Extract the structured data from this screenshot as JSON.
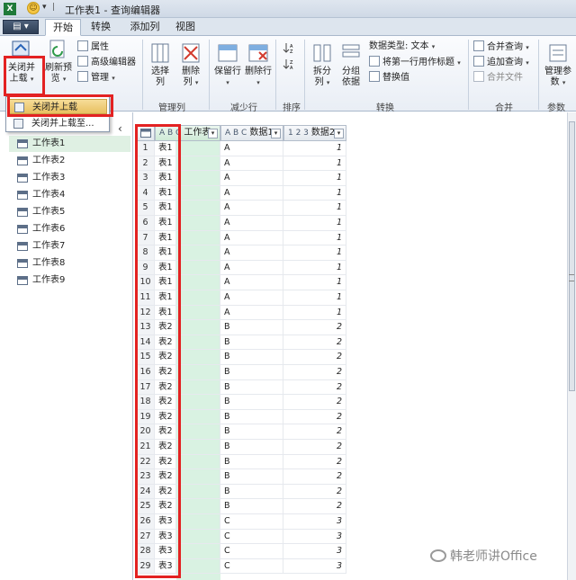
{
  "titlebar": {
    "app_icon": "X",
    "title": "工作表1 - 查询编辑器"
  },
  "ribbon_tabs": [
    {
      "label": "开始",
      "active": true
    },
    {
      "label": "转换",
      "active": false
    },
    {
      "label": "添加列",
      "active": false
    },
    {
      "label": "视图",
      "active": false
    }
  ],
  "ribbon": {
    "close": {
      "close_load_label": "关闭并上载",
      "refresh_label": "刷新预览",
      "properties_label": "属性",
      "advanced_editor_label": "高级编辑器",
      "manage_label": "管理"
    },
    "manage_columns": {
      "group_label": "管理列",
      "choose_columns_label": "选择列",
      "remove_columns_label": "删除列"
    },
    "reduce_rows": {
      "group_label": "减少行",
      "keep_rows_label": "保留行",
      "remove_rows_label": "删除行"
    },
    "sort": {
      "group_label": "排序"
    },
    "transform": {
      "group_label": "转换",
      "split_column_label": "拆分列",
      "group_by_label": "分组依据",
      "data_type_label": "数据类型: 文本",
      "first_row_header_label": "将第一行用作标题",
      "replace_values_label": "替换值"
    },
    "combine": {
      "group_label": "合并",
      "merge_queries_label": "合并查询",
      "append_queries_label": "追加查询",
      "combine_files_label": "合并文件"
    },
    "params": {
      "group_label": "参数",
      "manage_params_label": "管理参数"
    }
  },
  "dropdown_menu": {
    "items": [
      {
        "label": "关闭并上载",
        "highlighted": true
      },
      {
        "label": "关闭并上载至..."
      }
    ]
  },
  "nav_pane": {
    "queries": [
      "工作表1",
      "工作表2",
      "工作表3",
      "工作表4",
      "工作表5",
      "工作表6",
      "工作表7",
      "工作表8",
      "工作表9"
    ],
    "selected_index": 0
  },
  "grid": {
    "columns": [
      {
        "type_icon": "A B C",
        "name": "工作表"
      },
      {
        "type_icon": "A B C",
        "name": "数据1"
      },
      {
        "type_icon": "1 2 3",
        "name": "数据2"
      }
    ],
    "rows": [
      [
        "1",
        "表1",
        "",
        "A",
        "1"
      ],
      [
        "2",
        "表1",
        "",
        "A",
        "1"
      ],
      [
        "3",
        "表1",
        "",
        "A",
        "1"
      ],
      [
        "4",
        "表1",
        "",
        "A",
        "1"
      ],
      [
        "5",
        "表1",
        "",
        "A",
        "1"
      ],
      [
        "6",
        "表1",
        "",
        "A",
        "1"
      ],
      [
        "7",
        "表1",
        "",
        "A",
        "1"
      ],
      [
        "8",
        "表1",
        "",
        "A",
        "1"
      ],
      [
        "9",
        "表1",
        "",
        "A",
        "1"
      ],
      [
        "10",
        "表1",
        "",
        "A",
        "1"
      ],
      [
        "11",
        "表1",
        "",
        "A",
        "1"
      ],
      [
        "12",
        "表1",
        "",
        "A",
        "1"
      ],
      [
        "13",
        "表2",
        "",
        "B",
        "2"
      ],
      [
        "14",
        "表2",
        "",
        "B",
        "2"
      ],
      [
        "15",
        "表2",
        "",
        "B",
        "2"
      ],
      [
        "16",
        "表2",
        "",
        "B",
        "2"
      ],
      [
        "17",
        "表2",
        "",
        "B",
        "2"
      ],
      [
        "18",
        "表2",
        "",
        "B",
        "2"
      ],
      [
        "19",
        "表2",
        "",
        "B",
        "2"
      ],
      [
        "20",
        "表2",
        "",
        "B",
        "2"
      ],
      [
        "21",
        "表2",
        "",
        "B",
        "2"
      ],
      [
        "22",
        "表2",
        "",
        "B",
        "2"
      ],
      [
        "23",
        "表2",
        "",
        "B",
        "2"
      ],
      [
        "24",
        "表2",
        "",
        "B",
        "2"
      ],
      [
        "25",
        "表2",
        "",
        "B",
        "2"
      ],
      [
        "26",
        "表3",
        "",
        "C",
        "3"
      ],
      [
        "27",
        "表3",
        "",
        "C",
        "3"
      ],
      [
        "28",
        "表3",
        "",
        "C",
        "3"
      ],
      [
        "29",
        "表3",
        "",
        "C",
        "3"
      ]
    ]
  },
  "watermark": {
    "text": "韩老师讲Office"
  },
  "colors": {
    "highlight_red": "#e32222",
    "selected_green": "#d9f2e2",
    "menu_highlight": "#e8c060"
  }
}
